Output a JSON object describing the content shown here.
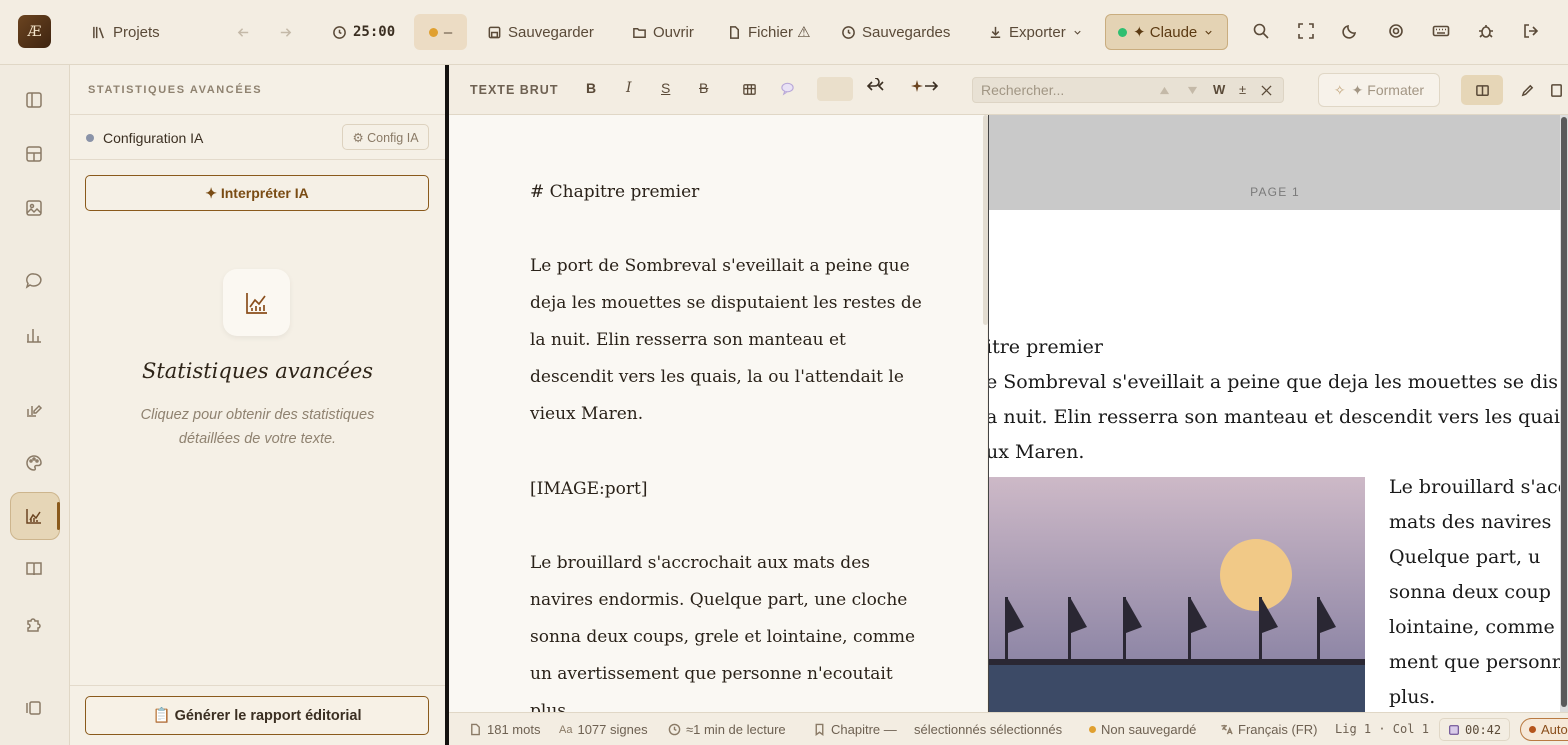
{
  "app": {
    "logo": "Æ"
  },
  "topbar": {
    "projects": "Projets",
    "timer": "25:00",
    "status_text": "–",
    "save": "Sauvegarder",
    "open": "Ouvrir",
    "file": "Fichier ⚠",
    "backups": "Sauvegardes",
    "export": "Exporter",
    "ai_model": "✦ Claude",
    "colors": {
      "accent": "#8a5a1c",
      "claude_dot": "#2fbf71",
      "status_dot": "#e0a030"
    }
  },
  "sidebar_rail": {
    "icons": [
      "panel-icon",
      "layout-icon",
      "image-icon",
      "chat-icon",
      "bar-chart-icon",
      "pen-chart-icon",
      "palette-icon",
      "stats-icon",
      "book-icon",
      "puzzle-icon",
      "collapse-icon"
    ],
    "active": "stats-icon"
  },
  "panel": {
    "title": "STATISTIQUES AVANCÉES",
    "config_label": "Configuration IA",
    "config_button": "⚙ Config IA",
    "interpret_button": "✦ Interpréter IA",
    "empty_title": "Statistiques avancées",
    "empty_subtitle": "Cliquez pour obtenir des statistiques détaillées de votre texte.",
    "report_button": "📋 Générer le rapport éditorial"
  },
  "editor_toolbar": {
    "mode_label": "TEXTE BRUT",
    "bold": "B",
    "italic": "I",
    "underline": "S",
    "strike": "B",
    "search_placeholder": "Rechercher...",
    "whole_word": "W",
    "case_toggle": "±",
    "format_button": "✦ Formater"
  },
  "editor": {
    "lines": [
      "# Chapitre premier",
      "Le port de Sombreval s'eveillait a peine que",
      "deja les mouettes se disputaient les restes de",
      "la nuit. Elin resserra son manteau et",
      "descendit vers les quais, la ou l'attendait le",
      "vieux Maren.",
      "[IMAGE:port]",
      "Le brouillard s'accrochait aux mats des",
      "navires endormis. Quelque part, une cloche",
      "sonna deux coups, grele et lointaine, comme",
      "un avertissement que personne n'ecoutait",
      "plus."
    ]
  },
  "preview": {
    "page_label": "PAGE 1",
    "lines": [
      "itre premier",
      "e Sombreval s'eveillait a peine que deja les mouettes se dis",
      "a nuit. Elin resserra son manteau et descendit vers les quais,",
      "ux Maren."
    ],
    "side_lines": [
      "Le brouillard s'acc",
      "mats des navires",
      "Quelque part, u",
      "sonna deux coup",
      "lointaine, comme u",
      "ment que personn",
      "plus."
    ]
  },
  "statusbar": {
    "words": "181 mots",
    "chars": "1077 signes",
    "reading": "≈1 min de lecture",
    "chapter": "Chapitre —",
    "selected": "sélectionnés sélectionnés",
    "unsaved": "Non sauvegardé",
    "language": "Français (FR)",
    "position": "Lig 1 · Col 1",
    "save_time": "00:42",
    "auto": "Auto"
  }
}
